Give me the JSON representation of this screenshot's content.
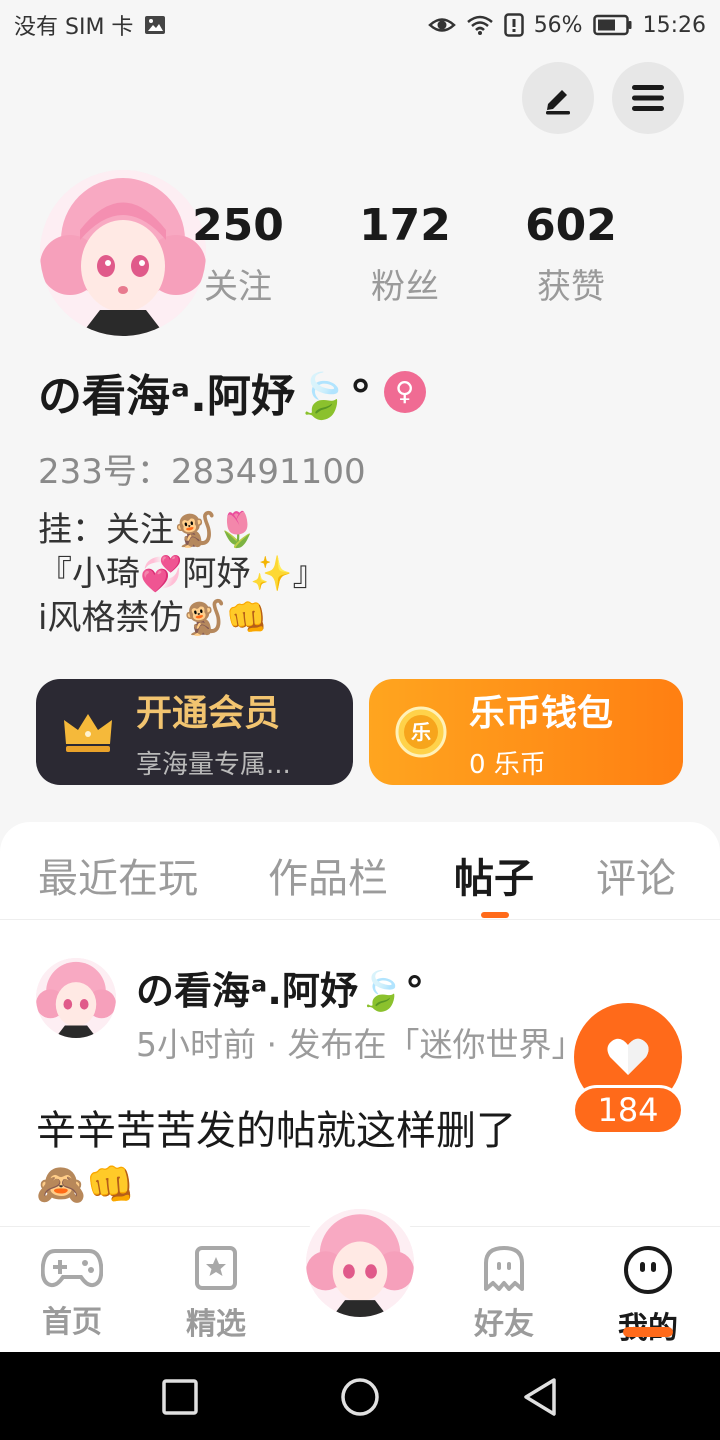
{
  "status_bar": {
    "carrier": "没有 SIM 卡",
    "battery": "56%",
    "time": "15:26",
    "icons": [
      "image-icon",
      "eye-icon",
      "wifi-icon",
      "alert-icon",
      "battery-icon"
    ]
  },
  "header": {
    "edit_icon": "edit-icon",
    "menu_icon": "menu-icon"
  },
  "profile": {
    "stats": [
      {
        "value": "250",
        "label": "关注"
      },
      {
        "value": "172",
        "label": "粉丝"
      },
      {
        "value": "602",
        "label": "获赞"
      }
    ],
    "nickname": "の看海ᵃ.阿妤🍃°",
    "gender_symbol": "♀",
    "uid": "233号：283491100",
    "bio": [
      "挂：关注🐒🌷",
      "『小琦💞阿妤✨』",
      "i风格禁仿🐒👊"
    ]
  },
  "cards": {
    "vip": {
      "title": "开通会员",
      "subtitle": "享海量专属...",
      "icon": "crown-icon"
    },
    "wallet": {
      "title": "乐币钱包",
      "subtitle": "0 乐币",
      "coin_glyph": "乐",
      "icon": "coin-icon"
    }
  },
  "tabs": [
    {
      "label": "最近在玩",
      "active": false
    },
    {
      "label": "作品栏",
      "active": false
    },
    {
      "label": "帖子",
      "active": true
    },
    {
      "label": "评论",
      "active": false
    }
  ],
  "post": {
    "author": "の看海ᵃ.阿妤🍃°",
    "meta": "5小时前 · 发布在「迷你世界」",
    "content": "辛辛苦苦发的帖就这样删了",
    "content_emoji": "🙈👊",
    "like_count": "184"
  },
  "bottom_nav": [
    {
      "label": "首页",
      "icon": "gamepad-icon",
      "active": false
    },
    {
      "label": "精选",
      "icon": "star-icon",
      "active": false
    },
    {
      "label": "",
      "icon": "avatar",
      "active": false
    },
    {
      "label": "好友",
      "icon": "ghost-icon",
      "active": false
    },
    {
      "label": "我的",
      "icon": "face-icon",
      "active": true
    }
  ],
  "colors": {
    "accent": "#ff6a1a",
    "vip_card": "#2b2933",
    "vip_gold": "#f2c470",
    "wallet_orange": "#ff9a18",
    "gender_pink": "#f06b93"
  }
}
